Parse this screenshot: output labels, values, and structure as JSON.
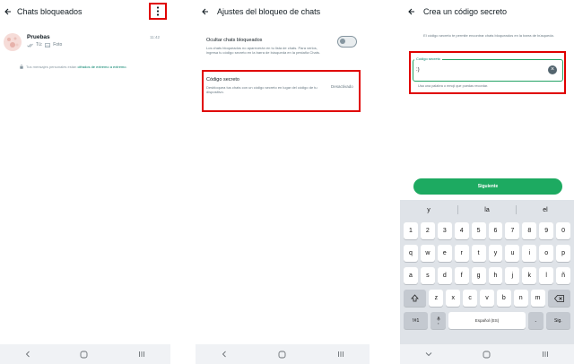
{
  "panel1": {
    "title": "Chats bloqueados",
    "chat": {
      "name": "Pruebas",
      "time": "11:42",
      "preview_sender": "Tú:",
      "preview_text": "Foto"
    },
    "notice_prefix": "Tus mensajes personales están",
    "notice_link": "cifrados de extremo a extremo",
    "notice_suffix": "."
  },
  "panel2": {
    "title": "Ajustes del bloqueo de chats",
    "hide_label": "Ocultar chats bloqueados",
    "hide_desc": "Los chats bloqueados no aparecerán en tu lista de chats. Para verlos, ingresa tu código secreto en la barra de búsqueda en la pestaña Chats.",
    "code_label": "Código secreto",
    "code_desc": "Desbloquea tus chats con un código secreto en lugar del código de tu dispositivo.",
    "code_status": "Desactivado"
  },
  "panel3": {
    "title": "Crea un código secreto",
    "info": "El código secreto te permite encontrar chats bloqueados en la barra de búsqueda.",
    "field_label": "Código secreto",
    "field_value": ":)",
    "hint": "Usa una palabra o emoji que puedas recordar.",
    "next_label": "Siguiente",
    "suggestions": [
      "y",
      "la",
      "el"
    ],
    "keyboard": {
      "row_numbers": [
        "1",
        "2",
        "3",
        "4",
        "5",
        "6",
        "7",
        "8",
        "9",
        "0"
      ],
      "row_q": [
        "q",
        "w",
        "e",
        "r",
        "t",
        "y",
        "u",
        "i",
        "o",
        "p"
      ],
      "row_a": [
        "a",
        "s",
        "d",
        "f",
        "g",
        "h",
        "j",
        "k",
        "l",
        "ñ"
      ],
      "row_z": [
        "z",
        "x",
        "c",
        "v",
        "b",
        "n",
        "m"
      ],
      "symbols_key": "!#1",
      "comma_key": ",",
      "space_label": "Español (ES)",
      "period_key": ".",
      "enter_key": "Sig."
    }
  },
  "colors": {
    "accent": "#008069",
    "button": "#1daa61",
    "highlight": "#e00000"
  }
}
